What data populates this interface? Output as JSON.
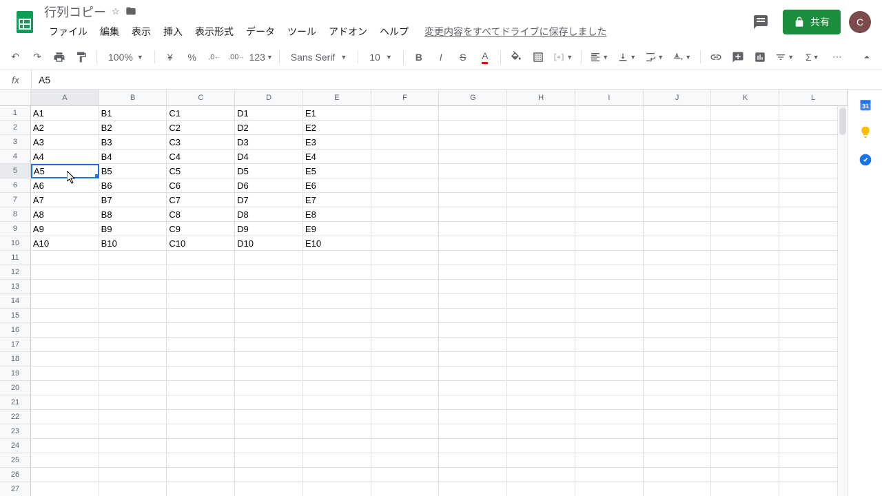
{
  "header": {
    "doc_title": "行列コピー",
    "save_status": "変更内容をすべてドライブに保存しました",
    "share_label": "共有",
    "avatar_initial": "C"
  },
  "menu": {
    "items": [
      "ファイル",
      "編集",
      "表示",
      "挿入",
      "表示形式",
      "データ",
      "ツール",
      "アドオン",
      "ヘルプ"
    ]
  },
  "toolbar": {
    "zoom": "100%",
    "currency": "¥",
    "percent": "%",
    "dec_dec": ".0",
    "inc_dec": ".00",
    "num_format": "123",
    "font": "Sans Serif",
    "font_size": "10"
  },
  "formula": {
    "value": "A5"
  },
  "sheet": {
    "selected_cell": "A5",
    "columns": [
      "A",
      "B",
      "C",
      "D",
      "E",
      "F",
      "G",
      "H",
      "I",
      "J",
      "K",
      "L"
    ],
    "active_col": 0,
    "active_row": 4,
    "num_rows": 27,
    "data": [
      [
        "A1",
        "B1",
        "C1",
        "D1",
        "E1",
        "",
        "",
        "",
        "",
        "",
        "",
        ""
      ],
      [
        "A2",
        "B2",
        "C2",
        "D2",
        "E2",
        "",
        "",
        "",
        "",
        "",
        "",
        ""
      ],
      [
        "A3",
        "B3",
        "C3",
        "D3",
        "E3",
        "",
        "",
        "",
        "",
        "",
        "",
        ""
      ],
      [
        "A4",
        "B4",
        "C4",
        "D4",
        "E4",
        "",
        "",
        "",
        "",
        "",
        "",
        ""
      ],
      [
        "A5",
        "B5",
        "C5",
        "D5",
        "E5",
        "",
        "",
        "",
        "",
        "",
        "",
        ""
      ],
      [
        "A6",
        "B6",
        "C6",
        "D6",
        "E6",
        "",
        "",
        "",
        "",
        "",
        "",
        ""
      ],
      [
        "A7",
        "B7",
        "C7",
        "D7",
        "E7",
        "",
        "",
        "",
        "",
        "",
        "",
        ""
      ],
      [
        "A8",
        "B8",
        "C8",
        "D8",
        "E8",
        "",
        "",
        "",
        "",
        "",
        "",
        ""
      ],
      [
        "A9",
        "B9",
        "C9",
        "D9",
        "E9",
        "",
        "",
        "",
        "",
        "",
        "",
        ""
      ],
      [
        "A10",
        "B10",
        "C10",
        "D10",
        "E10",
        "",
        "",
        "",
        "",
        "",
        "",
        ""
      ]
    ]
  }
}
